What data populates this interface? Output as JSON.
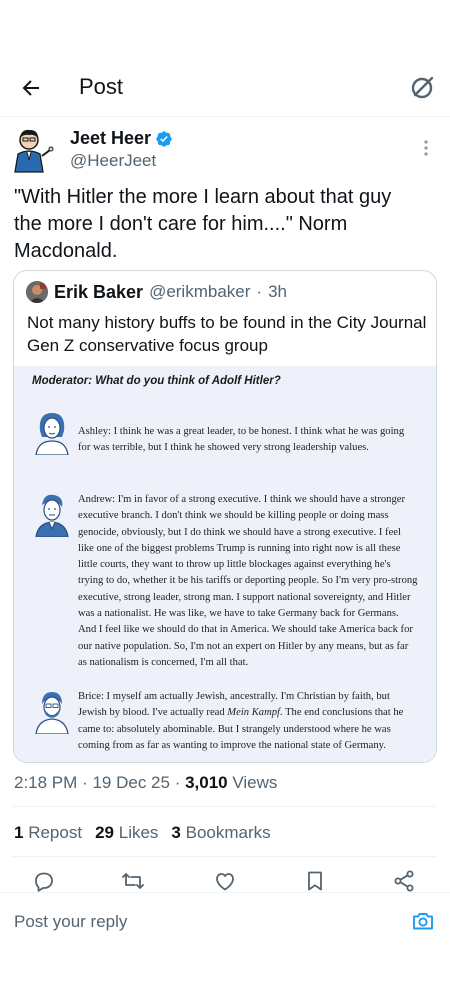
{
  "header": {
    "title": "Post",
    "back_icon": "arrow-left-icon",
    "grok_icon": "grok-icon"
  },
  "author": {
    "name": "Jeet Heer",
    "handle": "@HeerJeet",
    "verified": true
  },
  "tweet": {
    "text": "\"With Hitler the more I learn about that guy the more I don't care for him....\" Norm Macdonald."
  },
  "quote": {
    "name": "Erik Baker",
    "handle": "@erikmbaker",
    "separator": "·",
    "time": "3h",
    "text": "Not many history buffs to be found in the City Journal Gen Z conservative focus group",
    "media": {
      "moderator": "Moderator: What do you think of Adolf Hitler?",
      "responses": [
        {
          "text": "Ashley: I think he was a great leader, to be honest. I think what he was going for was terrible, but I think he showed very strong leadership values."
        },
        {
          "text": "Andrew: I'm in favor of a strong executive. I think we should have a stronger executive branch. I don't think we should be killing people or doing mass genocide, obviously, but I do think we should have a strong executive. I feel like one of the biggest problems Trump is running into right now is all these little courts, they want to throw up little blockages against everything he's trying to do, whether it be his tariffs or deporting people. So I'm very pro-strong executive, strong leader, strong man. I support national sovereignty, and Hitler was a nationalist. He was like, we have to take Germany back for Germans. And I feel like we should do that in America. We should take America back for our native population. So, I'm not an expert on Hitler by any means, but as far as nationalism is concerned, I'm all that."
        },
        {
          "text_before": "Brice: I myself am actually Jewish, ancestrally. I'm Christian by faith, but Jewish by blood. I've actually read ",
          "italic": "Mein Kampf",
          "text_after": ". The end conclusions that he came to: absolutely abominable. But I strangely understood where he was coming from as far as wanting to improve the national state of Germany."
        }
      ]
    }
  },
  "meta": {
    "time": "2:18 PM",
    "sep1": "·",
    "date": "19 Dec 25",
    "sep2": "·",
    "views_count": "3,010",
    "views_label": "Views"
  },
  "stats": {
    "reposts_count": "1",
    "reposts_label": "Repost",
    "likes_count": "29",
    "likes_label": "Likes",
    "bookmarks_count": "3",
    "bookmarks_label": "Bookmarks"
  },
  "actions": [
    "reply-icon",
    "repost-icon",
    "like-icon",
    "bookmark-icon",
    "share-icon"
  ],
  "reply_bar": {
    "placeholder": "Post your reply",
    "camera_icon": "camera-icon"
  },
  "colors": {
    "accent": "#1d9bf0",
    "text": "#0f1419",
    "secondary": "#536471",
    "media_bg": "#eef1fa"
  }
}
